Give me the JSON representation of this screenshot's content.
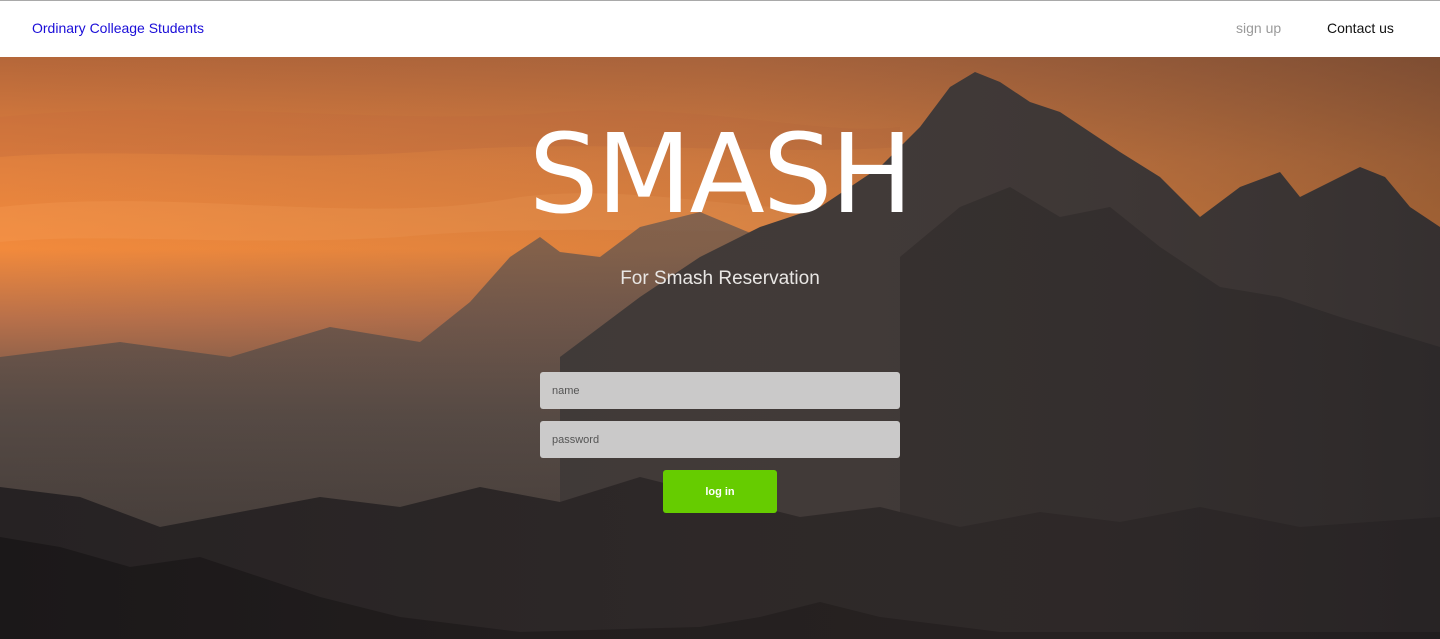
{
  "nav": {
    "brand": "Ordinary Colleage Students",
    "signup_label": "sign up",
    "contact_label": "Contact us"
  },
  "hero": {
    "title": "SMASH",
    "subtitle": "For Smash Reservation",
    "background": "mountain-sunset"
  },
  "login_form": {
    "name_placeholder": "name",
    "password_placeholder": "password",
    "login_label": "log in"
  },
  "colors": {
    "brand_link": "#1a0dd8",
    "muted_link": "#9a9a9a",
    "button": "#66cc00",
    "sky_orange": "#f2873a"
  }
}
